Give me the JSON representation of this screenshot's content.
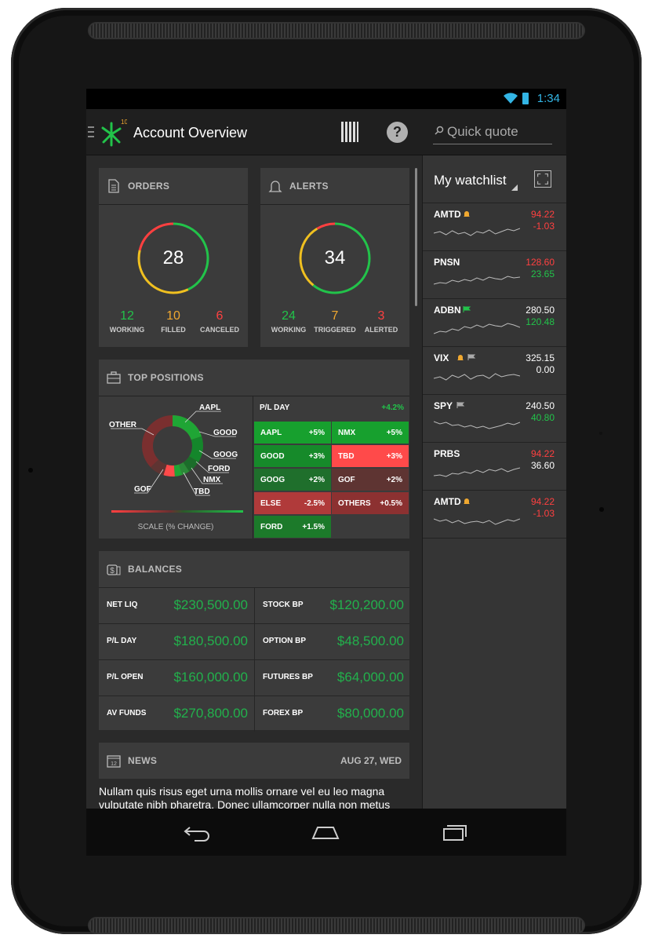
{
  "status_bar": {
    "time": "1:34"
  },
  "app": {
    "title": "Account Overview",
    "logo_badge": "10",
    "help_label": "?"
  },
  "search": {
    "placeholder": "Quick quote"
  },
  "orders": {
    "title": "ORDERS",
    "total": "28",
    "stats": [
      {
        "value": "12",
        "label": "WORKING",
        "color": "#22c34a"
      },
      {
        "value": "10",
        "label": "FILLED",
        "color": "#f0a830"
      },
      {
        "value": "6",
        "label": "CANCELED",
        "color": "#ff4040"
      }
    ]
  },
  "alerts": {
    "title": "ALERTS",
    "total": "34",
    "stats": [
      {
        "value": "24",
        "label": "WORKING",
        "color": "#22c34a"
      },
      {
        "value": "7",
        "label": "TRIGGERED",
        "color": "#f0a830"
      },
      {
        "value": "3",
        "label": "ALERTED",
        "color": "#ff4040"
      }
    ]
  },
  "top_positions": {
    "title": "TOP POSITIONS",
    "donut_labels": [
      "OTHER",
      "AAPL",
      "GOOD",
      "GOOG",
      "FORD",
      "NMX",
      "TBD",
      "GOF"
    ],
    "scale_label": "SCALE (% CHANGE)",
    "pl_day_label": "P/L DAY",
    "pl_day_value": "+4.2%",
    "cells": [
      {
        "name": "AAPL",
        "pct": "+5%",
        "color": "#17a02e"
      },
      {
        "name": "NMX",
        "pct": "+5%",
        "color": "#17a02e"
      },
      {
        "name": "GOOD",
        "pct": "+3%",
        "color": "#168a2a"
      },
      {
        "name": "TBD",
        "pct": "+3%",
        "color": "#ff4a4a"
      },
      {
        "name": "GOOG",
        "pct": "+2%",
        "color": "#1f6f2c"
      },
      {
        "name": "GOF",
        "pct": "+2%",
        "color": "#5e3432"
      },
      {
        "name": "ELSE",
        "pct": "-2.5%",
        "color": "#b03a3a"
      },
      {
        "name": "OTHERS",
        "pct": "+0.5%",
        "color": "#8c3131"
      },
      {
        "name": "FORD",
        "pct": "+1.5%",
        "color": "#1c7a2a"
      }
    ]
  },
  "balances": {
    "title": "BALANCES",
    "rows": [
      [
        {
          "label": "NET LIQ",
          "value": "$230,500.00"
        },
        {
          "label": "STOCK BP",
          "value": "$120,200.00"
        }
      ],
      [
        {
          "label": "P/L DAY",
          "value": "$180,500.00"
        },
        {
          "label": "OPTION BP",
          "value": "$48,500.00"
        }
      ],
      [
        {
          "label": "P/L OPEN",
          "value": "$160,000.00"
        },
        {
          "label": "FUTURES BP",
          "value": "$64,000.00"
        }
      ],
      [
        {
          "label": "AV FUNDS",
          "value": "$270,800.00"
        },
        {
          "label": "FOREX BP",
          "value": "$80,000.00"
        }
      ]
    ]
  },
  "news": {
    "title": "NEWS",
    "date": "AUG 27, WED",
    "calendar_day": "12",
    "text": "Nullam quis risus eget urna mollis ornare vel eu leo magna vulputate nibh pharetra. Donec ullamcorper nulla non metus"
  },
  "watchlist": {
    "title": "My watchlist",
    "items": [
      {
        "symbol": "AMTD",
        "flags": [
          "bell"
        ],
        "price": "94.22",
        "change": "-1.03",
        "price_color": "#ff4040",
        "change_color": "#ff4040"
      },
      {
        "symbol": "PNSN",
        "flags": [],
        "price": "128.60",
        "change": "23.65",
        "price_color": "#ff4040",
        "change_color": "#22c34a"
      },
      {
        "symbol": "ADBN",
        "flags": [
          "green-flag"
        ],
        "price": "280.50",
        "change": "120.48",
        "price_color": "#ffffff",
        "change_color": "#22c34a"
      },
      {
        "symbol": "VIX",
        "flags": [
          "bell",
          "gray-flag"
        ],
        "price": "325.15",
        "change": "0.00",
        "price_color": "#ffffff",
        "change_color": "#ffffff"
      },
      {
        "symbol": "SPY",
        "flags": [
          "gray-flag"
        ],
        "price": "240.50",
        "change": "40.80",
        "price_color": "#ffffff",
        "change_color": "#22c34a"
      },
      {
        "symbol": "PRBS",
        "flags": [],
        "price": "94.22",
        "change": "36.60",
        "price_color": "#ff4040",
        "change_color": "#ffffff"
      },
      {
        "symbol": "AMTD",
        "flags": [
          "bell"
        ],
        "price": "94.22",
        "change": "-1.03",
        "price_color": "#ff4040",
        "change_color": "#ff4040"
      }
    ]
  },
  "colors": {
    "accent": "#33b5e5",
    "positive": "#22c34a",
    "negative": "#ff4040",
    "warning": "#f0a830"
  }
}
